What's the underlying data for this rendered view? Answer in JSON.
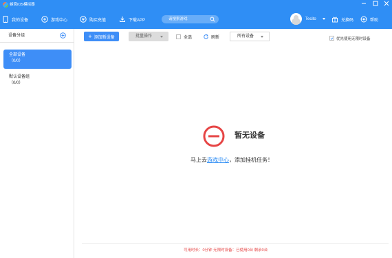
{
  "app": {
    "title": "蜂窝iOS模拟器"
  },
  "nav": [
    {
      "label": "我的设备",
      "icon": "phone-icon"
    },
    {
      "label": "游戏中心",
      "icon": "gamepad-icon"
    },
    {
      "label": "购买充值",
      "icon": "recharge-icon"
    },
    {
      "label": "下载APP",
      "icon": "download-icon"
    }
  ],
  "search": {
    "placeholder": "请搜索游戏"
  },
  "user": {
    "name": "Tecito"
  },
  "topActions": {
    "redeem": "兑换码",
    "help": "帮助"
  },
  "sidebar": {
    "title": "设备分组",
    "groups": [
      {
        "name": "全部设备",
        "count": "（0/0）",
        "active": true
      },
      {
        "name": "默认设备组",
        "count": "（0/0）",
        "active": false
      }
    ]
  },
  "toolbar": {
    "add": "添加新设备",
    "batch": "批量操作",
    "selectAll": "全选",
    "refresh": "刷新",
    "filter": "所有设备",
    "prefer": "优先使用无限时设备",
    "preferChecked": true
  },
  "empty": {
    "title": "暂无设备",
    "msgPrefix": "马上去",
    "link": "游戏中心",
    "msgSuffix": "，添加挂机任务！"
  },
  "status": "可用时长：0分钟 无限时设备：已使用0台 剩余0台",
  "colors": {
    "primary": "#2f8ef5",
    "danger": "#e64545"
  }
}
